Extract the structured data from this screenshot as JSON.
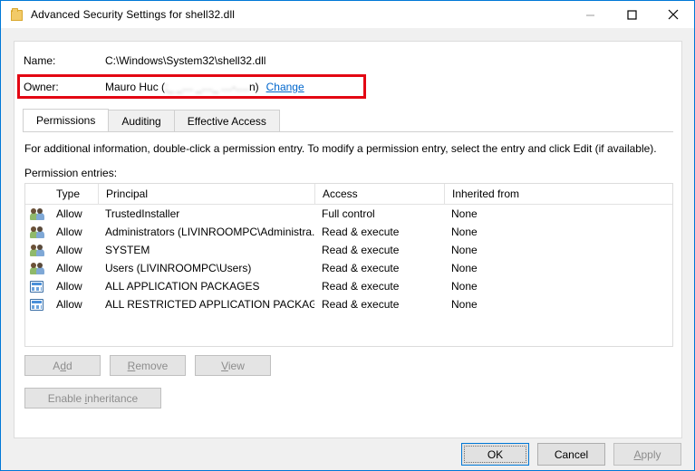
{
  "window": {
    "title": "Advanced Security Settings for shell32.dll",
    "icon": "folder-icon",
    "minimize_label": "Minimize",
    "maximize_label": "Maximize",
    "close_label": "Close",
    "accent_color": "#0078d7"
  },
  "fields": {
    "name_label": "Name:",
    "name_value": "C:\\Windows\\System32\\shell32.dll",
    "owner_label": "Owner:",
    "owner_value": "Mauro Huc (",
    "owner_blurred": ";_ _.... _...._ ....-.....",
    "owner_value_end": "n)",
    "change_link": "Change",
    "highlight_color": "#e30613"
  },
  "tabs": [
    {
      "label": "Permissions",
      "active": true
    },
    {
      "label": "Auditing",
      "active": false
    },
    {
      "label": "Effective Access",
      "active": false
    }
  ],
  "panel": {
    "info_text": "For additional information, double-click a permission entry. To modify a permission entry, select the entry and click Edit (if available).",
    "entries_label": "Permission entries:"
  },
  "table": {
    "headers": [
      "Type",
      "Principal",
      "Access",
      "Inherited from"
    ],
    "rows": [
      {
        "icon": "users-icon",
        "type": "Allow",
        "principal": "TrustedInstaller",
        "access": "Full control",
        "inherited": "None"
      },
      {
        "icon": "users-icon",
        "type": "Allow",
        "principal": "Administrators (LIVINROOMPC\\Administra...",
        "access": "Read & execute",
        "inherited": "None"
      },
      {
        "icon": "users-icon",
        "type": "Allow",
        "principal": "SYSTEM",
        "access": "Read & execute",
        "inherited": "None"
      },
      {
        "icon": "users-icon",
        "type": "Allow",
        "principal": "Users (LIVINROOMPC\\Users)",
        "access": "Read & execute",
        "inherited": "None"
      },
      {
        "icon": "app-package-icon",
        "type": "Allow",
        "principal": "ALL APPLICATION PACKAGES",
        "access": "Read & execute",
        "inherited": "None"
      },
      {
        "icon": "app-package-icon",
        "type": "Allow",
        "principal": "ALL RESTRICTED APPLICATION PACKAGES",
        "access": "Read & execute",
        "inherited": "None"
      }
    ]
  },
  "buttons": {
    "add": "Add",
    "add_accel": "d",
    "remove": "Remove",
    "remove_accel": "R",
    "view": "View",
    "view_accel": "V",
    "enable_inheritance": "Enable inheritance",
    "enable_inheritance_accel": "i",
    "ok": "OK",
    "cancel": "Cancel",
    "apply": "Apply",
    "apply_accel": "A"
  }
}
